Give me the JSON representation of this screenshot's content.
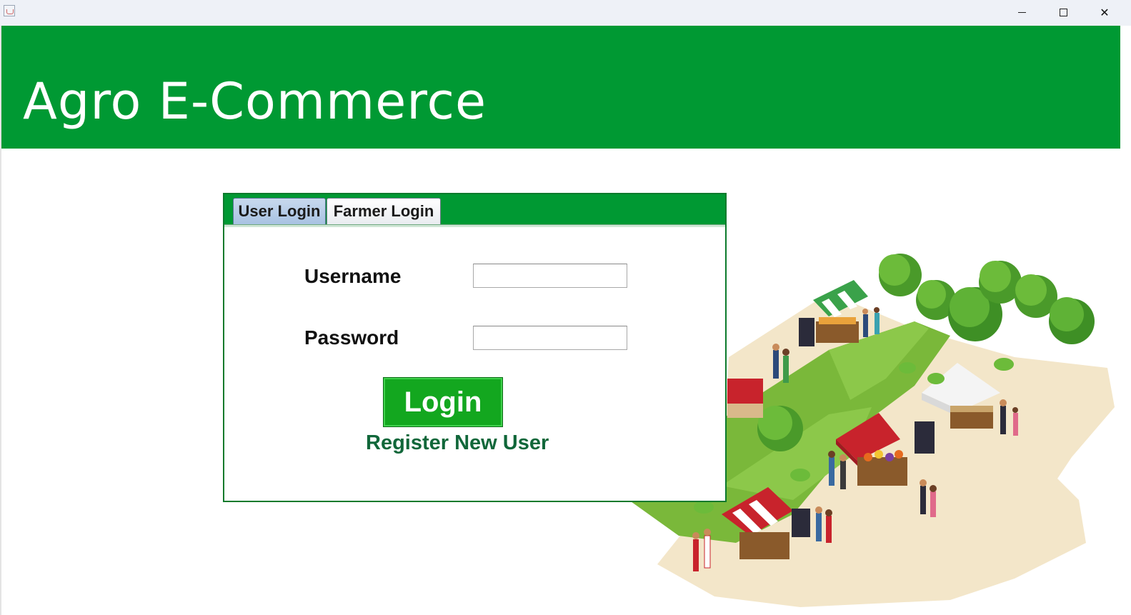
{
  "window": {
    "app_icon": "java-cup-icon",
    "controls": {
      "minimize": "minimize-icon",
      "maximize": "maximize-icon",
      "close": "✕"
    }
  },
  "header": {
    "title": "Agro E-Commerce",
    "background_color": "#009933"
  },
  "tabs": [
    {
      "label": "User Login",
      "selected": true
    },
    {
      "label": "Farmer Login",
      "selected": false
    }
  ],
  "form": {
    "username_label": "Username",
    "username_value": "",
    "password_label": "Password",
    "password_value": "",
    "login_button": "Login",
    "register_link": "Register New User"
  },
  "illustration": {
    "subject": "farmers-market-isometric-illustration"
  },
  "colors": {
    "accent_green": "#009933",
    "button_green": "#13a71f",
    "link_green": "#11673a"
  }
}
